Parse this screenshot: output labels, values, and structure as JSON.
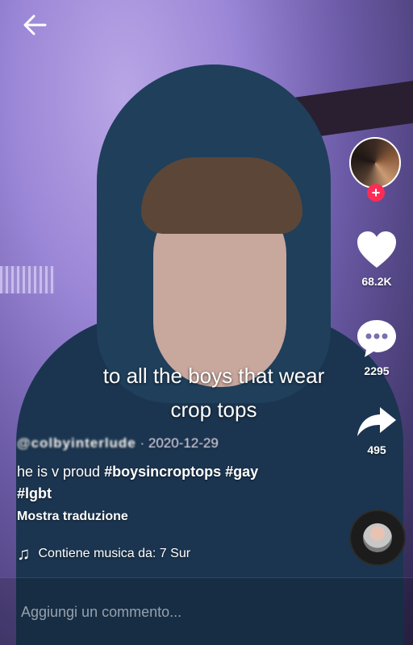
{
  "nav": {
    "back_icon": "arrow-left-icon"
  },
  "video": {
    "caption_line1": "to all the boys that wear",
    "caption_line2": "crop tops"
  },
  "actions": {
    "likes": "68.2K",
    "comments": "2295",
    "shares": "495"
  },
  "post": {
    "username": "@colbyinterlude",
    "date": " · 2020-12-29",
    "description_text": "he is v proud ",
    "tags": [
      "#boysincroptops",
      "#gay",
      "#lgbt"
    ],
    "translate_label": "Mostra traduzione",
    "music": "Contiene musica da: 7 Sur"
  },
  "comment_bar": {
    "placeholder": "Aggiungi un commento..."
  },
  "colors": {
    "follow": "#fe2c55",
    "text": "#ffffff"
  }
}
